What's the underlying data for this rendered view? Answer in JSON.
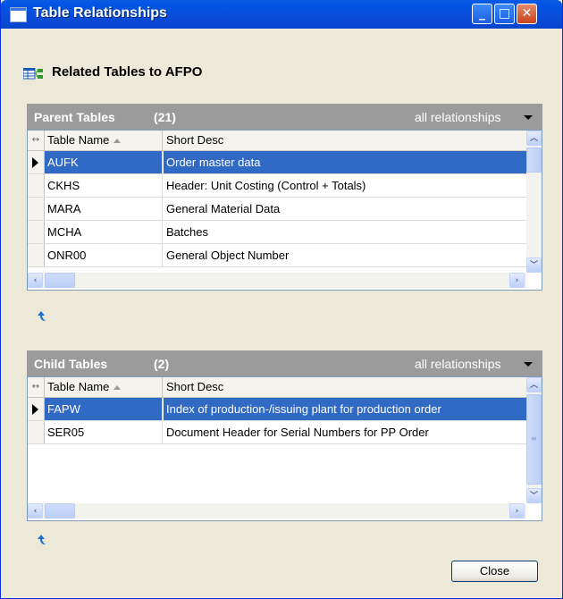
{
  "window": {
    "title": "Table Relationships",
    "buttons": {
      "minimize": "_",
      "maximize": "□",
      "close": "✕"
    }
  },
  "header": {
    "text": "Related Tables to AFPO",
    "icon": "table-relation-icon"
  },
  "parent_panel": {
    "title": "Parent Tables",
    "count": "(21)",
    "filter": "all relationships",
    "columns": {
      "table_name": "Table Name",
      "short_desc": "Short Desc"
    },
    "rows": [
      {
        "name": "AUFK",
        "desc": "Order master data",
        "selected": true
      },
      {
        "name": "CKHS",
        "desc": "Header: Unit Costing (Control + Totals)",
        "selected": false
      },
      {
        "name": "MARA",
        "desc": "General Material Data",
        "selected": false
      },
      {
        "name": "MCHA",
        "desc": "Batches",
        "selected": false
      },
      {
        "name": "ONR00",
        "desc": "General Object Number",
        "selected": false
      }
    ]
  },
  "child_panel": {
    "title": "Child Tables",
    "count": "(2)",
    "filter": "all relationships",
    "columns": {
      "table_name": "Table Name",
      "short_desc": "Short Desc"
    },
    "rows": [
      {
        "name": "FAPW",
        "desc": "Index of production-/issuing plant for production order",
        "selected": true
      },
      {
        "name": "SER05",
        "desc": "Document Header for Serial Numbers for PP Order",
        "selected": false
      }
    ]
  },
  "footer": {
    "close_label": "Close"
  },
  "colors": {
    "selection": "#316ac5",
    "panel_header": "#9b9b9b",
    "title_bar": "#0054e3"
  }
}
